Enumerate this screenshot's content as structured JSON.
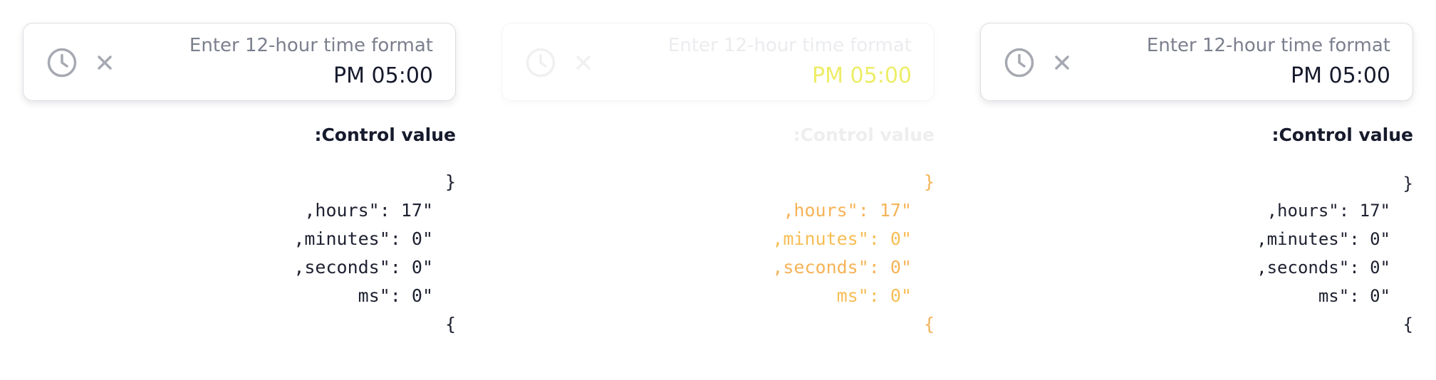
{
  "panels": [
    {
      "input": {
        "label": "Enter 12-hour time format",
        "value": "PM 05:00"
      },
      "control_value_label": ":Control value",
      "code_lines": [
        "}",
        ",hours\": 17\"",
        ",minutes\": 0\"",
        ",seconds\": 0\"",
        "ms\": 0\"",
        "{"
      ]
    },
    {
      "input": {
        "label": "Enter 12-hour time format",
        "value": "PM 05:00"
      },
      "control_value_label": ":Control value",
      "code_lines": [
        "}",
        ",hours\": 17\"",
        ",minutes\": 0\"",
        ",seconds\": 0\"",
        "ms\": 0\"",
        "{"
      ]
    },
    {
      "input": {
        "label": "Enter 12-hour time format",
        "value": "PM 05:00"
      },
      "control_value_label": ":Control value",
      "code_lines": [
        "}",
        ",hours\": 17\"",
        ",minutes\": 0\"",
        ",seconds\": 0\"",
        "ms\": 0\"",
        "{"
      ]
    }
  ],
  "icons": {
    "clock": "clock-icon",
    "clear": "close-icon"
  },
  "colors": {
    "text_primary": "#161a2c",
    "text_muted": "#7b7f8d",
    "icon": "#a7a9b2",
    "border": "#dcdde2"
  }
}
